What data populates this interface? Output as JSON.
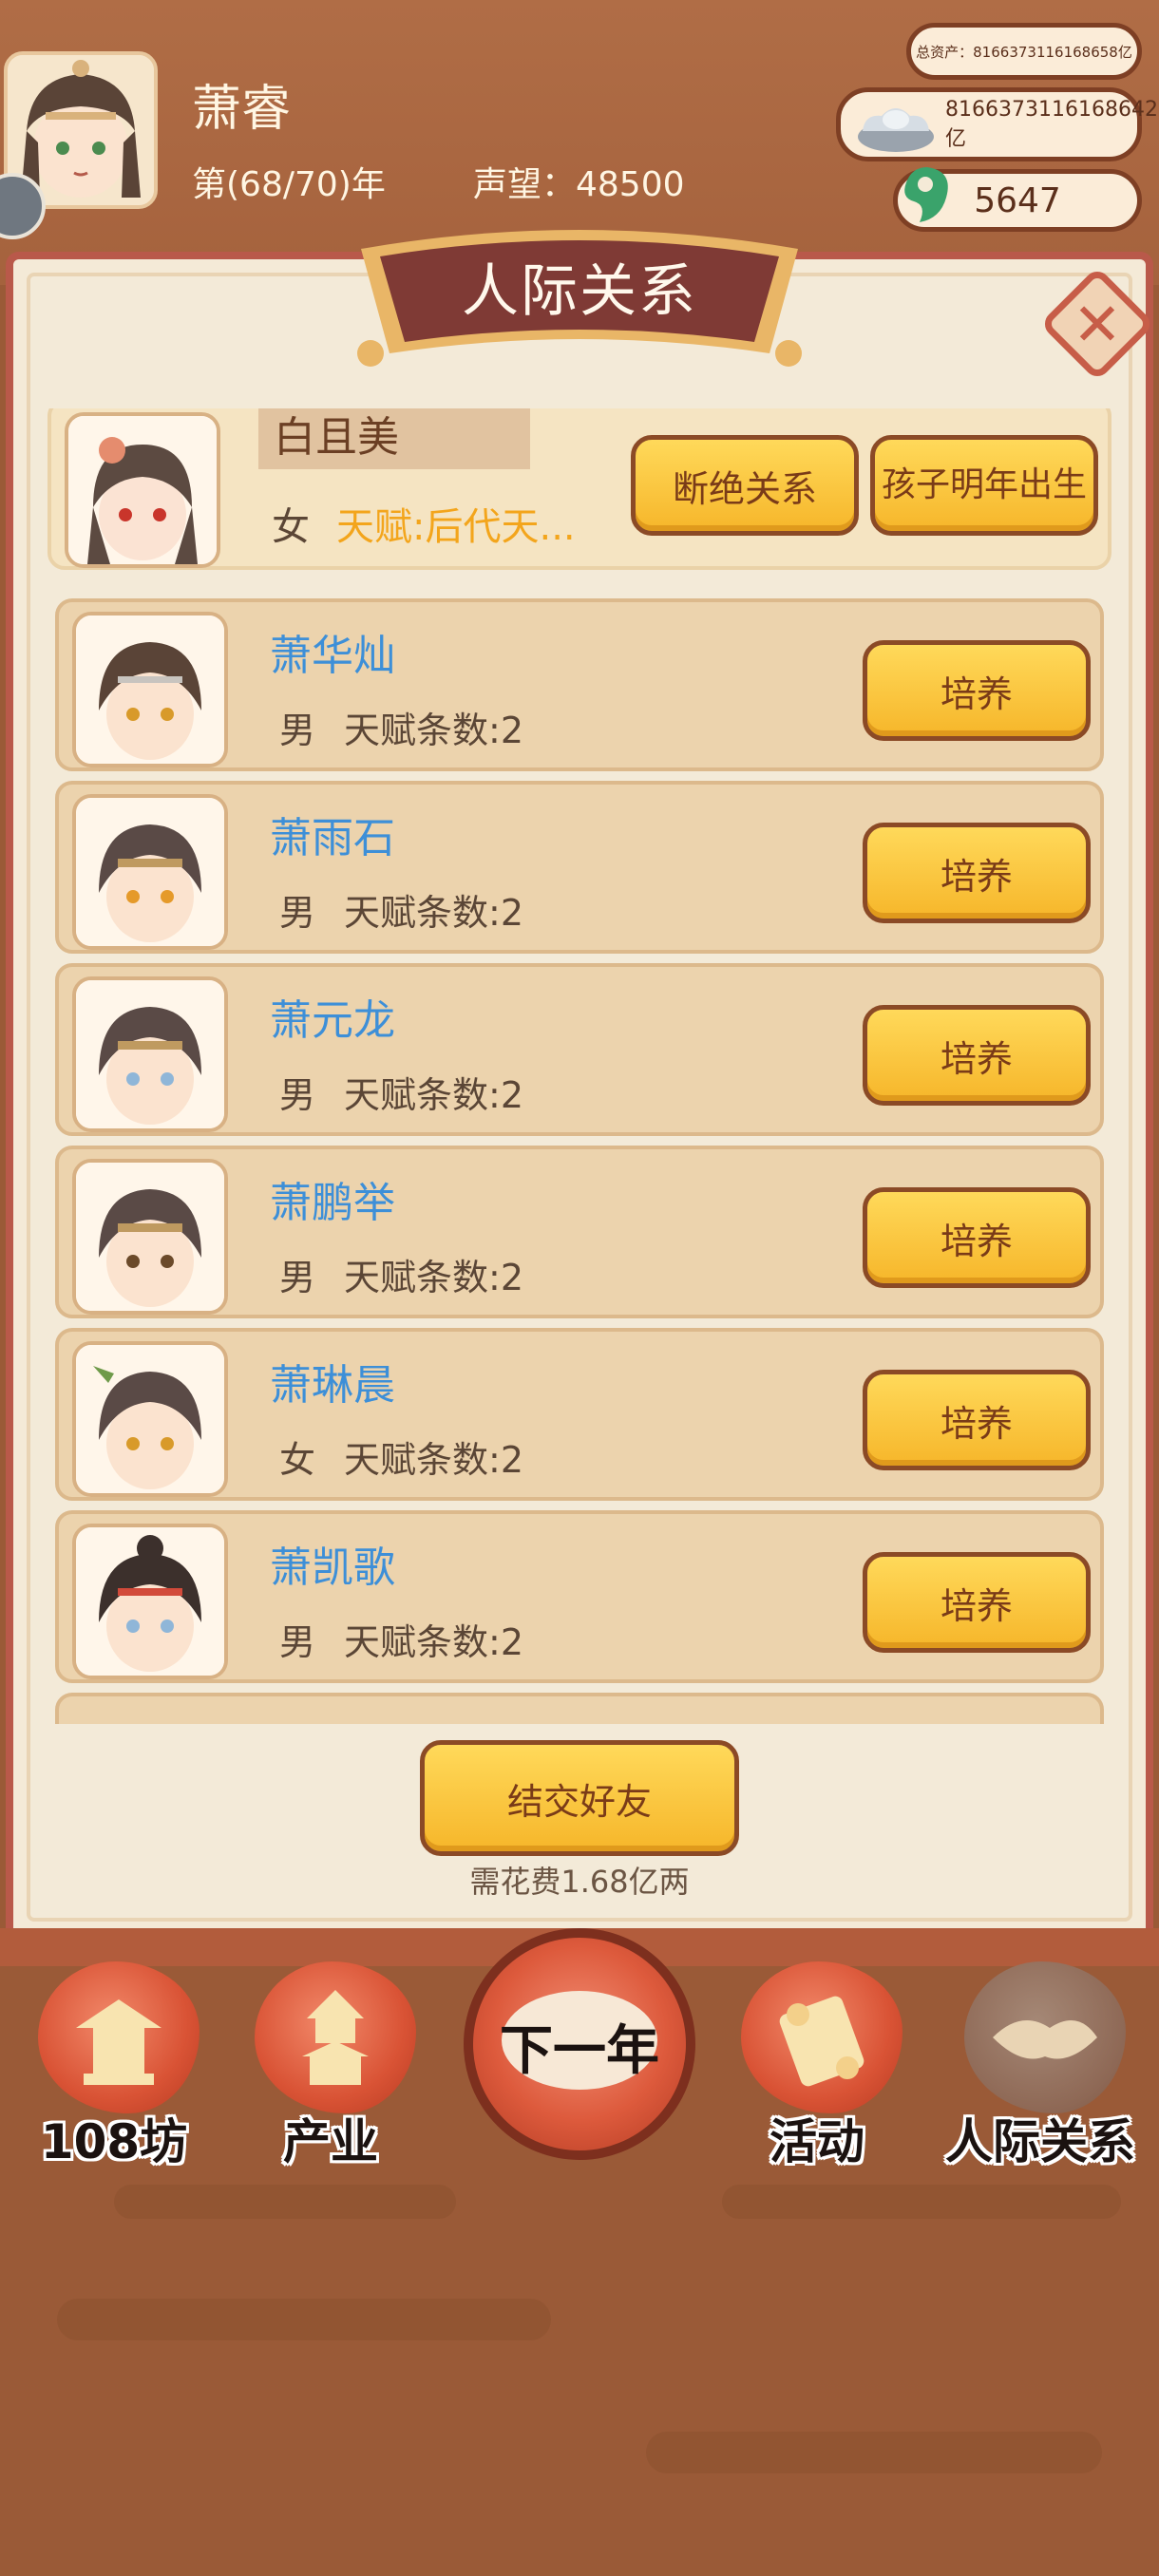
{
  "header": {
    "player_name": "萧睿",
    "year_text": "第(68/70)年",
    "fame_text": "声望：48500"
  },
  "resources": {
    "total_assets": "总资产：8166373116168658亿",
    "silver": "8166373116168642亿",
    "jade": "5647"
  },
  "panel": {
    "title": "人际关系",
    "close_icon": "close-icon"
  },
  "spouse": {
    "name": "白且美",
    "gender": "女",
    "talent": "天赋:后代天...",
    "break_label": "断绝关系",
    "child_label": "孩子明年出生"
  },
  "children": [
    {
      "name": "萧华灿",
      "gender": "男",
      "talent": "天赋条数:2",
      "action": "培养"
    },
    {
      "name": "萧雨石",
      "gender": "男",
      "talent": "天赋条数:2",
      "action": "培养"
    },
    {
      "name": "萧元龙",
      "gender": "男",
      "talent": "天赋条数:2",
      "action": "培养"
    },
    {
      "name": "萧鹏举",
      "gender": "男",
      "talent": "天赋条数:2",
      "action": "培养"
    },
    {
      "name": "萧琳晨",
      "gender": "女",
      "talent": "天赋条数:2",
      "action": "培养"
    },
    {
      "name": "萧凯歌",
      "gender": "男",
      "talent": "天赋条数:2",
      "action": "培养"
    }
  ],
  "footer": {
    "make_friend_label": "结交好友",
    "cost_text": "需花费1.68亿两"
  },
  "nav": {
    "items": [
      {
        "label": "108坊",
        "icon": "pavilion-icon"
      },
      {
        "label": "产业",
        "icon": "tower-icon"
      },
      {
        "label": "下一年",
        "icon": "next-year-icon"
      },
      {
        "label": "活动",
        "icon": "scroll-icon"
      },
      {
        "label": "人际关系",
        "icon": "handshake-icon"
      }
    ]
  },
  "colors": {
    "background": "#9a5a37",
    "panel_border": "#b9594a",
    "name_blue": "#3d8fd8",
    "talent_gold": "#f3a51c",
    "button_gold": "#f6b62a"
  }
}
